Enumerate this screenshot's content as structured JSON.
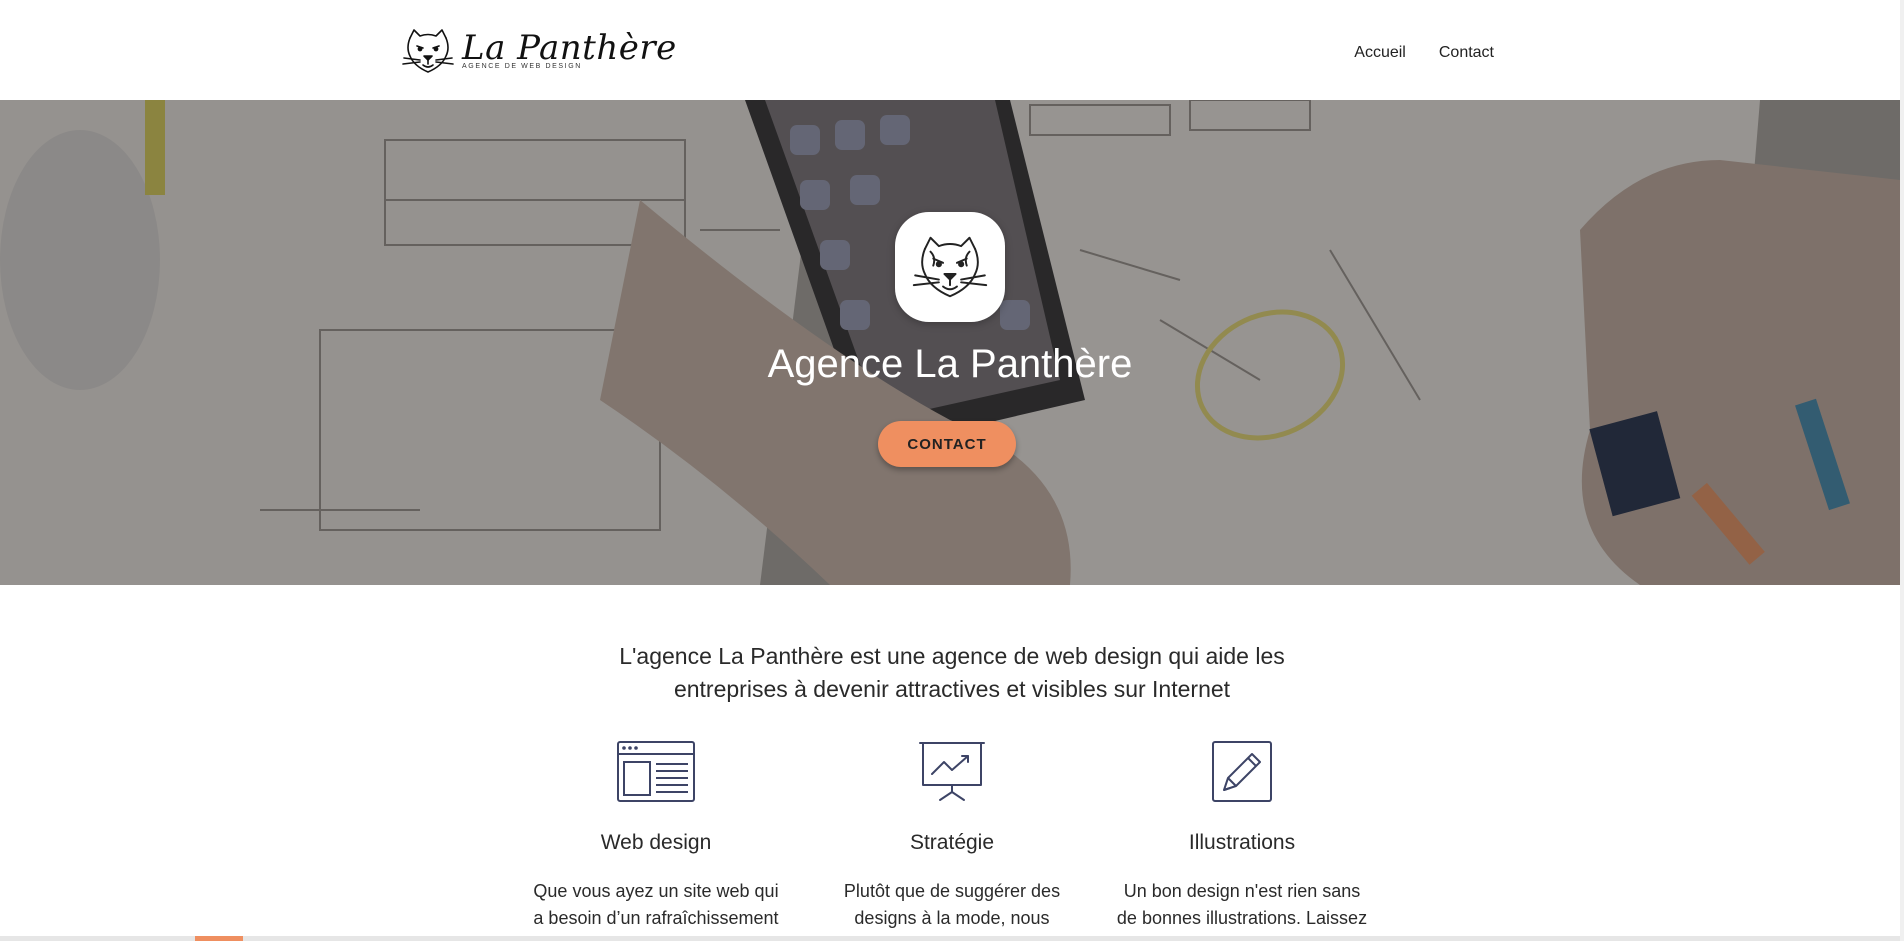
{
  "header": {
    "logo_title": "La Panthère",
    "logo_subtitle": "Agence de web design",
    "nav": [
      {
        "label": "Accueil"
      },
      {
        "label": "Contact"
      }
    ]
  },
  "hero": {
    "title": "Agence La Panthère",
    "cta_label": "CONTACT"
  },
  "intro": {
    "text": "L'agence La Panthère est une agence de web design qui aide les entreprises à devenir attractives et visibles sur Internet"
  },
  "services": [
    {
      "icon": "browser-window-icon",
      "title": "Web design",
      "text": "Que vous ayez un site web qui a besoin d’un rafraîchissement"
    },
    {
      "icon": "presentation-chart-icon",
      "title": "Stratégie",
      "text": "Plutôt que de suggérer des designs à la mode, nous"
    },
    {
      "icon": "pencil-edit-icon",
      "title": "Illustrations",
      "text": "Un bon design n'est rien sans de bonnes illustrations. Laissez"
    }
  ],
  "colors": {
    "accent": "#ef8f60",
    "icon_stroke": "#3d4466",
    "text": "#2a2a2a"
  }
}
